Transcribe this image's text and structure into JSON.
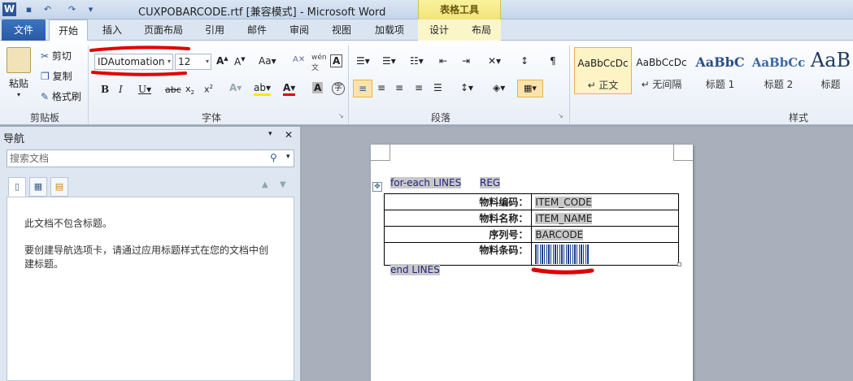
{
  "window": {
    "title": "CUXPOBARCODE.rtf [兼容模式] - Microsoft Word",
    "app_icon_letter": "W",
    "contextual_group": "表格工具"
  },
  "tabs": {
    "file": "文件",
    "home": "开始",
    "insert": "插入",
    "page_layout": "页面布局",
    "references": "引用",
    "mailings": "邮件",
    "review": "审阅",
    "view": "视图",
    "addins": "加载项",
    "design": "设计",
    "layout": "布局"
  },
  "clipboard": {
    "paste": "粘贴",
    "cut": "剪切",
    "copy": "复制",
    "format_painter": "格式刷",
    "group_label": "剪贴板"
  },
  "font": {
    "name": "IDAutomation",
    "size": "12",
    "group_label": "字体"
  },
  "paragraph": {
    "group_label": "段落"
  },
  "styles": {
    "group_label": "样式",
    "items": [
      {
        "sample": "AaBbCcDc",
        "name": "↵ 正文"
      },
      {
        "sample": "AaBbCcDc",
        "name": "↵ 无间隔"
      },
      {
        "sample": "AaBbC",
        "name": "标题 1"
      },
      {
        "sample": "AaBbCc",
        "name": "标题 2"
      },
      {
        "sample": "AaB",
        "name": "标题"
      }
    ]
  },
  "nav": {
    "title": "导航",
    "search_placeholder": "搜索文档",
    "no_headings": "此文档不包含标题。",
    "instructions": "要创建导航选项卡，请通过应用标题样式在您的文档中创建标题。"
  },
  "document": {
    "for_each": "for-each LINES",
    "reg": "REG",
    "end": "end LINES",
    "rows": [
      {
        "label": "物料编码：",
        "value": "ITEM_CODE"
      },
      {
        "label": "物料名称：",
        "value": "ITEM_NAME"
      },
      {
        "label": "序列号：",
        "value": "BARCODE"
      },
      {
        "label": "物料条码：",
        "value": ""
      }
    ]
  },
  "colors": {
    "accent": "#2b579a",
    "highlight_red": "#e00000",
    "contextual_yellow": "#f3e37a"
  }
}
